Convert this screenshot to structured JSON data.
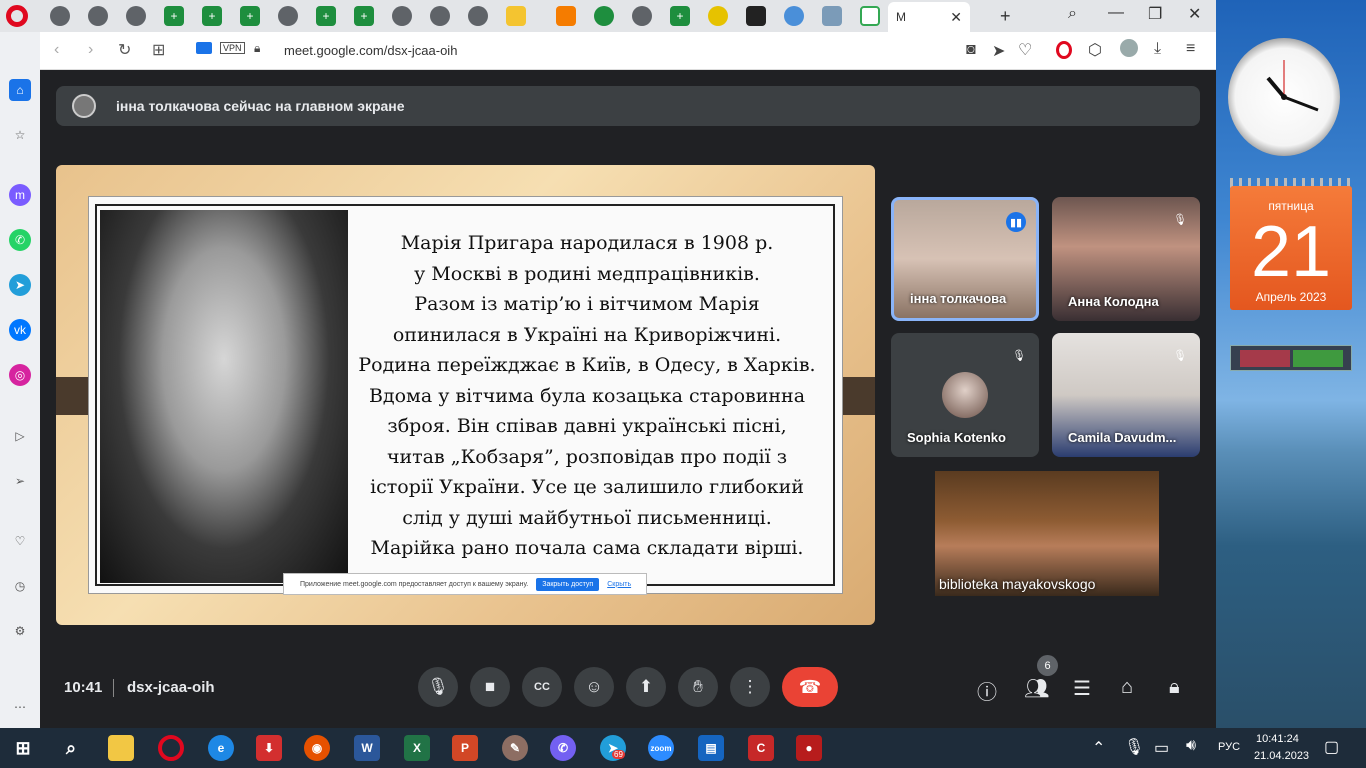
{
  "browser": {
    "active_tab_label": "М",
    "url": "meet.google.com/dsx-jcaa-oih",
    "vpn_label": "VPN"
  },
  "meet": {
    "banner_text": "інна толкачова сейчас на главном экране",
    "slide_lines": [
      "Марія Пригара народилася в 1908 р.",
      "у Москві в родині медпрацівників.",
      "Разом із матір’ю і вітчимом Марія",
      "опинилася в Україні на Криворіжчині.",
      "Родина переїжджає в Київ, в Одесу, в Харків.",
      "Вдома у вітчима була козацька старовинна",
      "зброя. Він співав давні українські пісні,",
      "читав „Кобзаря”, розповідав про події з",
      "історії України. Усе це залишило глибокий",
      "слід у душі майбутньої письменниці.",
      "Марійка рано почала сама складати вірші."
    ],
    "share_notice": {
      "text": "Приложение meet.google.com предоставляет доступ к вашему экрану.",
      "stop_button": "Закрыть доступ",
      "hide_link": "Скрыть"
    },
    "participants": [
      {
        "name": "інна толкачова"
      },
      {
        "name": "Анна Колодна"
      },
      {
        "name": "Sophia Kotenko"
      },
      {
        "name": "Camila Davudm..."
      }
    ],
    "self_view_name": "biblioteka mayakovskogo",
    "time": "10:41",
    "meeting_code": "dsx-jcaa-oih",
    "participant_count": "6"
  },
  "gadgets": {
    "calendar_weekday": "пятница",
    "calendar_day": "21",
    "calendar_month": "Апрель 2023"
  },
  "taskbar": {
    "lang": "РУС",
    "time": "10:41:24",
    "date": "21.04.2023",
    "telegram_badge": "69",
    "zoom_label": "zoom"
  },
  "colors": {
    "meet_bg": "#202124",
    "end_call": "#ea4335",
    "active_speaker_border": "#8ab4f8",
    "calendar": "#e4571f"
  }
}
